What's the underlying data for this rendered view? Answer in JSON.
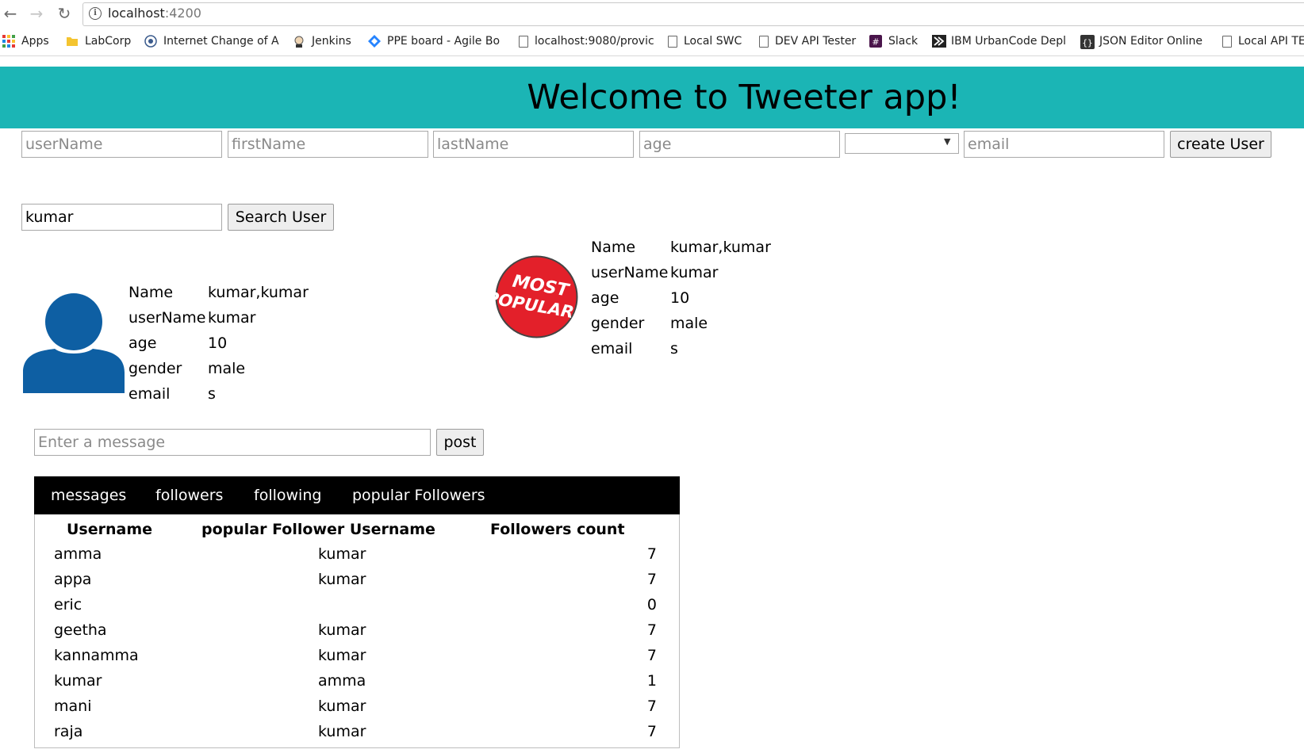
{
  "browser": {
    "url_host": "localhost",
    "url_port": ":4200",
    "bookmarks": [
      {
        "label": "Apps",
        "icon": "apps-grid-icon"
      },
      {
        "label": "LabCorp",
        "icon": "folder-icon"
      },
      {
        "label": "Internet Change of A",
        "icon": "globe-icon"
      },
      {
        "label": "Jenkins",
        "icon": "jenkins-icon"
      },
      {
        "label": "PPE board - Agile Bo",
        "icon": "diamond-icon"
      },
      {
        "label": "localhost:9080/provic",
        "icon": "page-icon"
      },
      {
        "label": "Local SWC",
        "icon": "page-icon"
      },
      {
        "label": "DEV API Tester",
        "icon": "page-icon"
      },
      {
        "label": "Slack",
        "icon": "slack-icon"
      },
      {
        "label": "IBM UrbanCode Depl",
        "icon": "urbancode-icon"
      },
      {
        "label": "JSON Editor Online",
        "icon": "json-icon"
      },
      {
        "label": "Local API TE",
        "icon": "page-icon"
      }
    ]
  },
  "header": {
    "title": "Welcome to Tweeter app!",
    "bg_color": "#1bb5b5"
  },
  "create_form": {
    "username_placeholder": "userName",
    "firstname_placeholder": "firstName",
    "lastname_placeholder": "lastName",
    "age_placeholder": "age",
    "email_placeholder": "email",
    "create_label": "create User"
  },
  "search": {
    "value": "kumar",
    "button_label": "Search User"
  },
  "profile": {
    "name_key": "Name",
    "name_value": "kumar,kumar",
    "username_key": "userName",
    "username_value": "kumar",
    "age_key": "age",
    "age_value": "10",
    "gender_key": "gender",
    "gender_value": "male",
    "email_key": "email",
    "email_value": "s"
  },
  "popular": {
    "badge_line1": "MOST",
    "badge_line2": "POPULAR!",
    "name_key": "Name",
    "name_value": "kumar,kumar",
    "username_key": "userName",
    "username_value": "kumar",
    "age_key": "age",
    "age_value": "10",
    "gender_key": "gender",
    "gender_value": "male",
    "email_key": "email",
    "email_value": "s"
  },
  "post": {
    "placeholder": "Enter a message",
    "button_label": "post"
  },
  "tabs": [
    "messages",
    "followers",
    "following",
    "popular Followers"
  ],
  "table": {
    "headers": [
      "Username",
      "popular Follower Username",
      "Followers count"
    ],
    "rows": [
      [
        "amma",
        "kumar",
        "7"
      ],
      [
        "appa",
        "kumar",
        "7"
      ],
      [
        "eric",
        "",
        "0"
      ],
      [
        "geetha",
        "kumar",
        "7"
      ],
      [
        "kannamma",
        "kumar",
        "7"
      ],
      [
        "kumar",
        "amma",
        "1"
      ],
      [
        "mani",
        "kumar",
        "7"
      ],
      [
        "raja",
        "kumar",
        "7"
      ]
    ]
  }
}
